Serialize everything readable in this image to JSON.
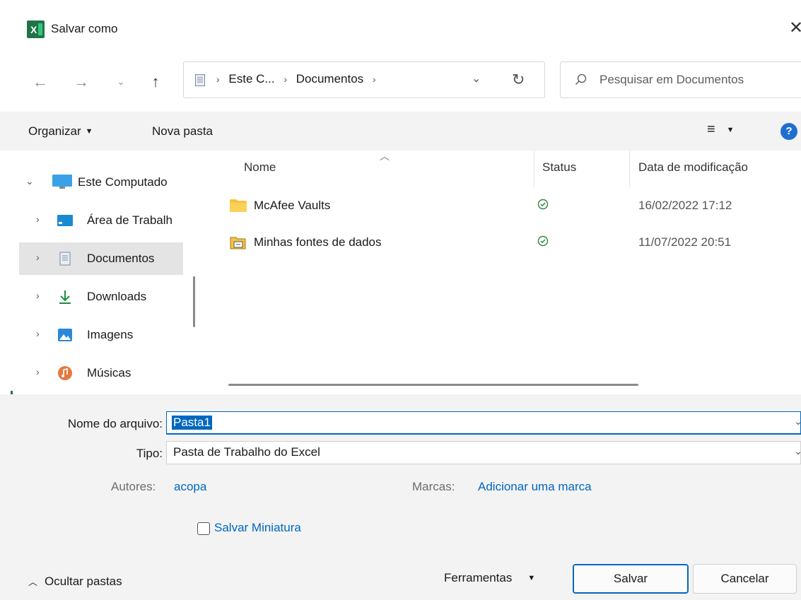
{
  "window": {
    "title": "Salvar como",
    "app_icon_letter": "X",
    "close_glyph": "✕"
  },
  "nav": {
    "back_icon": "arrow-left",
    "forward_icon": "arrow-right",
    "recent_icon": "chevron-down",
    "up_icon": "arrow-up",
    "breadcrumbs": [
      "Este C...",
      "Documentos"
    ],
    "search_placeholder": "Pesquisar em Documentos"
  },
  "toolbar": {
    "organize_label": "Organizar",
    "new_folder_label": "Nova pasta",
    "help_label": "?"
  },
  "sidebar": {
    "items": [
      {
        "label": "Este Computado",
        "icon": "computer-icon",
        "expanded": true
      },
      {
        "label": "Área de Trabalh",
        "icon": "desktop-icon"
      },
      {
        "label": "Documentos",
        "icon": "documents-icon",
        "selected": true
      },
      {
        "label": "Downloads",
        "icon": "downloads-icon"
      },
      {
        "label": "Imagens",
        "icon": "pictures-icon"
      },
      {
        "label": "Músicas",
        "icon": "music-icon"
      }
    ]
  },
  "files": {
    "columns": {
      "name": "Nome",
      "status": "Status",
      "date": "Data de modificação"
    },
    "rows": [
      {
        "name": "McAfee Vaults",
        "icon": "folder-icon",
        "status": "synced",
        "date": "16/02/2022 17:12"
      },
      {
        "name": "Minhas fontes de dados",
        "icon": "datasource-folder-icon",
        "status": "synced",
        "date": "11/07/2022 20:51"
      }
    ]
  },
  "form": {
    "filename_label": "Nome do arquivo:",
    "filename_value": "Pasta1",
    "type_label": "Tipo:",
    "type_value": "Pasta de Trabalho do Excel",
    "authors_label": "Autores:",
    "authors_value": "acopa",
    "tags_label": "Marcas:",
    "tags_value": "Adicionar uma marca",
    "thumbnail_label": "Salvar Miniatura",
    "thumbnail_checked": false
  },
  "footer": {
    "hide_folders_label": "Ocultar pastas",
    "tools_label": "Ferramentas",
    "save_label": "Salvar",
    "cancel_label": "Cancelar"
  },
  "colors": {
    "excel_green": "#217346",
    "accent_blue": "#0067c0",
    "status_green": "#2e8540"
  }
}
